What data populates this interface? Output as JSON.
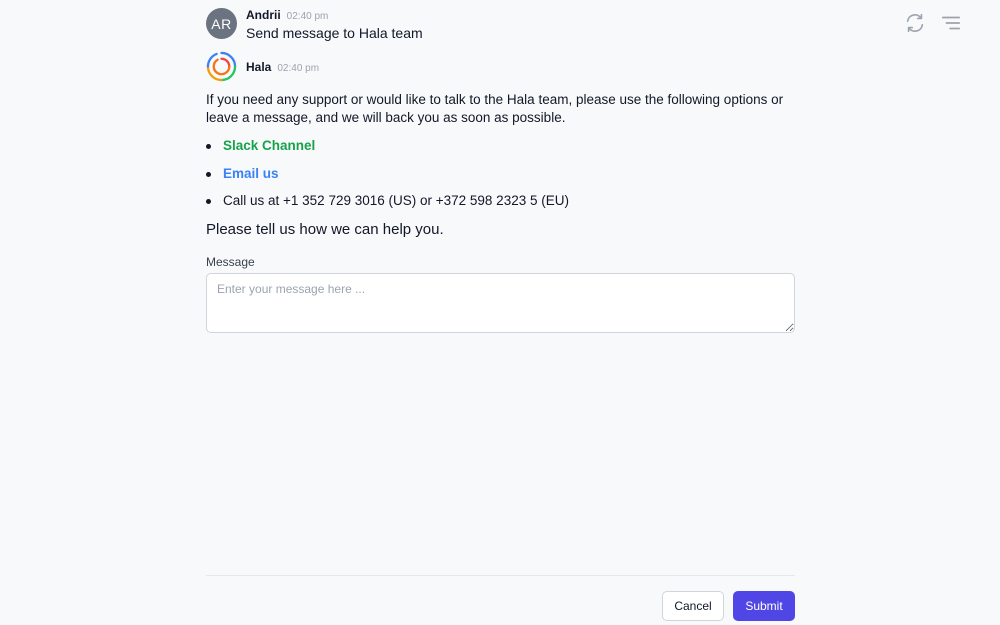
{
  "toolbar": {
    "refresh_icon": "refresh-icon",
    "menu_icon": "menu-icon"
  },
  "conversation": {
    "user_message": {
      "avatar_initials": "AR",
      "author": "Andrii",
      "time": "02:40 pm",
      "text": "Send message to Hala team"
    },
    "bot_message": {
      "author": "Hala",
      "time": "02:40 pm",
      "intro": "If you need any support or would like to talk to the Hala team, please use the following options or leave a message, and we will back you as soon as possible.",
      "options": {
        "slack": "Slack Channel",
        "email": "Email us",
        "call": "Call us at +1 352 729 3016 (US) or +372 598 2323 5 (EU)"
      },
      "prompt": "Please tell us how we can help you."
    }
  },
  "form": {
    "message_label": "Message",
    "message_placeholder": "Enter your message here ...",
    "message_value": "",
    "cancel_label": "Cancel",
    "submit_label": "Submit"
  },
  "colors": {
    "accent": "#4f46e5",
    "slack_link": "#16a34a",
    "email_link": "#3b82f6",
    "avatar_bg": "#6b7280"
  }
}
